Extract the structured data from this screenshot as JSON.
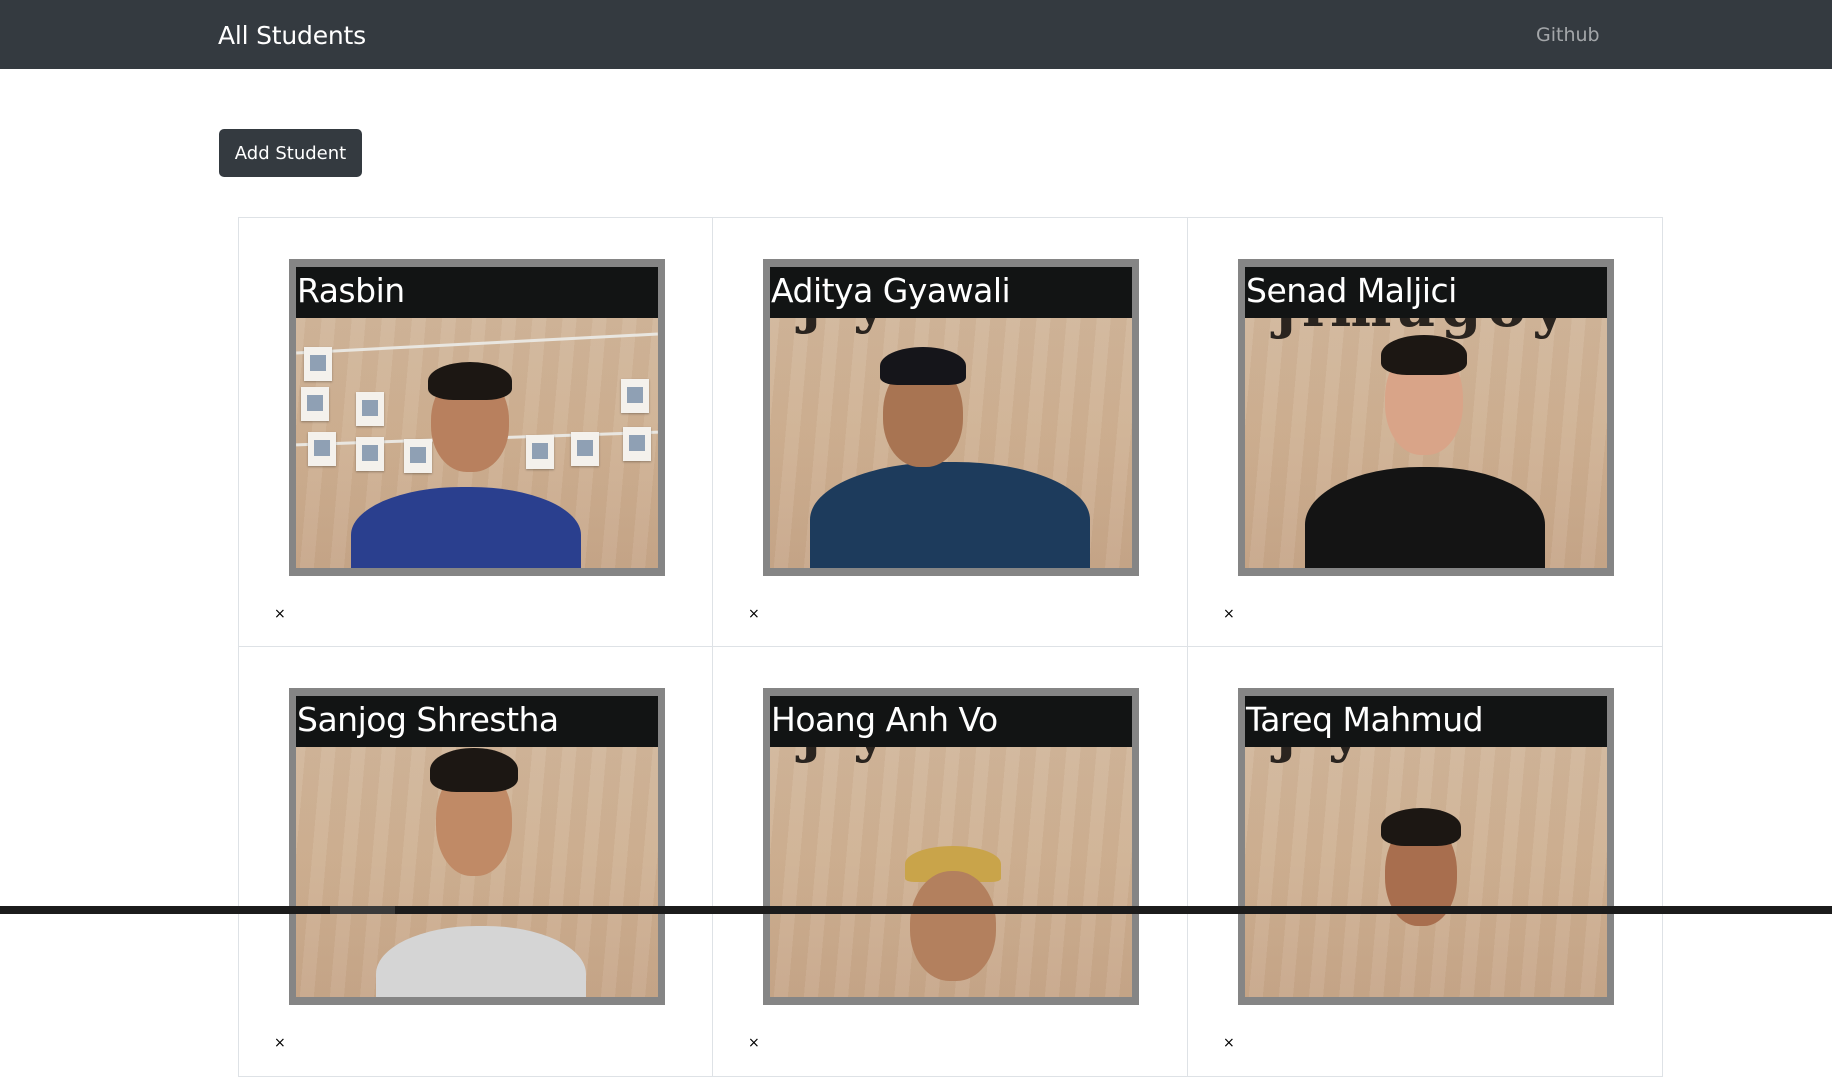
{
  "navbar": {
    "brand": "All Students",
    "link": "Github"
  },
  "actions": {
    "add_label": "Add Student"
  },
  "students": [
    {
      "name": "Rasbin",
      "remove": "×"
    },
    {
      "name": "Aditya Gyawali",
      "remove": "×"
    },
    {
      "name": "Senad Maljici",
      "remove": "×"
    },
    {
      "name": "Sanjog Shrestha",
      "remove": "×"
    },
    {
      "name": "Hoang Anh Vo",
      "remove": "×"
    },
    {
      "name": "Tareq Mahmud",
      "remove": "×"
    }
  ],
  "colors": {
    "navbar": "#343a40",
    "button": "#343a40",
    "name_bar": "#121414",
    "photo_frame": "#858585"
  }
}
